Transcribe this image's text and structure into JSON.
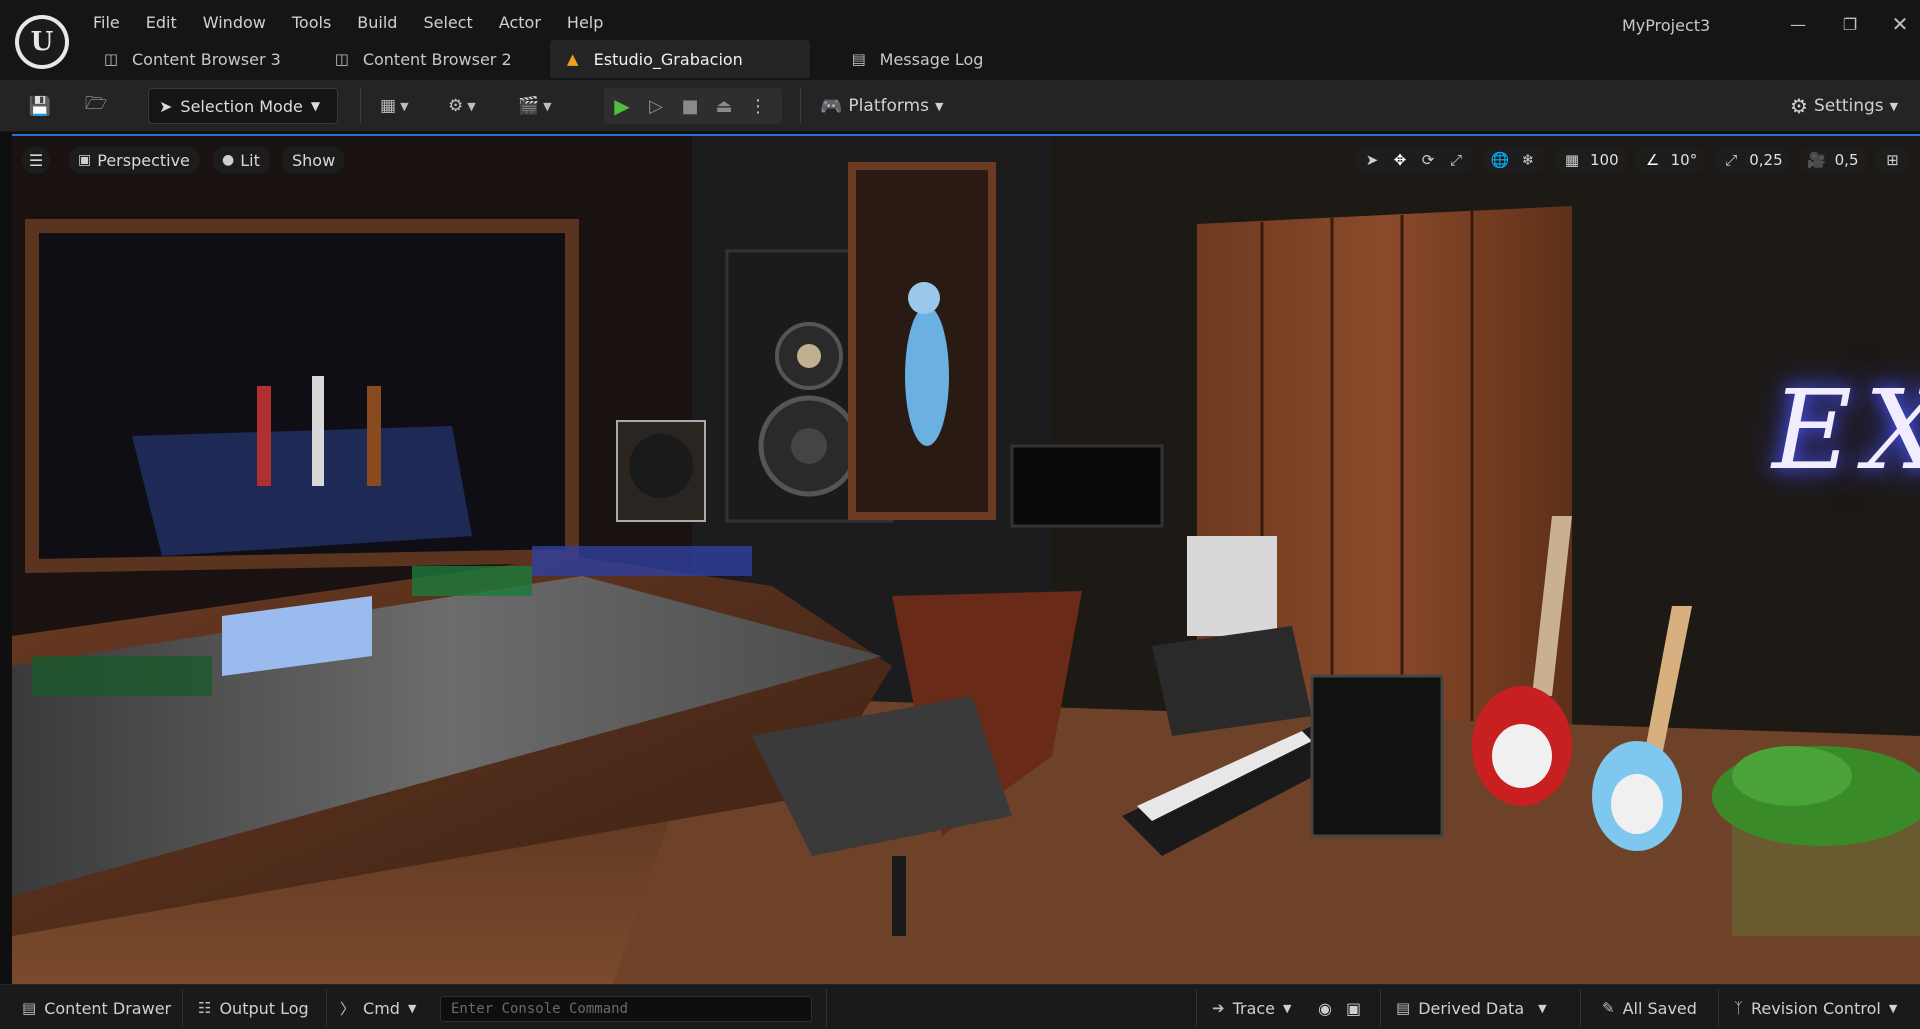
{
  "menu": [
    "File",
    "Edit",
    "Window",
    "Tools",
    "Build",
    "Select",
    "Actor",
    "Help"
  ],
  "project_name": "MyProject3",
  "tabs": [
    {
      "label": "Content Browser 3",
      "icon": "content-browser-icon"
    },
    {
      "label": "Content Browser 2",
      "icon": "content-browser-icon"
    },
    {
      "label": "Estudio_Grabacion",
      "icon": "level-warning-icon",
      "active": true
    },
    {
      "label": "Message Log",
      "icon": "message-log-icon"
    }
  ],
  "toolbar": {
    "selection_mode": "Selection Mode",
    "platforms": "Platforms",
    "settings": "Settings"
  },
  "viewport": {
    "perspective": "Perspective",
    "lit": "Lit",
    "show": "Show",
    "grid_snap": "100",
    "rotation_snap": "10°",
    "scale_snap": "0,25",
    "camera_speed": "0,5",
    "sign_text": "EX"
  },
  "statusbar": {
    "content_drawer": "Content Drawer",
    "output_log": "Output Log",
    "cmd": "Cmd",
    "console_placeholder": "Enter Console Command",
    "trace": "Trace",
    "derived_data": "Derived Data",
    "all_saved": "All Saved",
    "revision_control": "Revision Control"
  },
  "colors": {
    "accent": "#1f6fd1",
    "play_green": "#4fbe3c",
    "warning": "#f0a020"
  }
}
